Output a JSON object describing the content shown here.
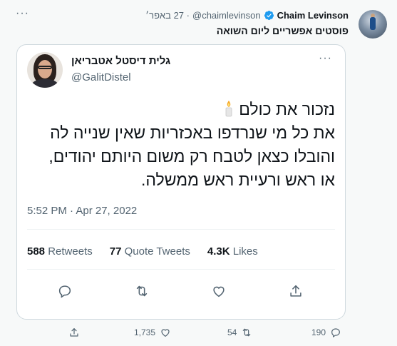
{
  "outer_tweet": {
    "author_name": "Chaim Levinson",
    "handle": "@chaimlevinson",
    "time": "· 27 באפר׳",
    "text": "פוסטים אפשריים ליום השואה",
    "more_label": "···",
    "counts": {
      "replies": "190",
      "retweets": "54",
      "likes": "1,735"
    }
  },
  "quoted_tweet": {
    "author_name": "גלית דיסטל אטבריאן",
    "handle": "@GalitDistel",
    "more_label": "···",
    "body_lines": [
      "נזכור את כולם",
      "את כל מי שנרדפו באכזריות שאין שנייה לה",
      "והובלו כצאן לטבח רק משום היותם יהודים,",
      "או ראש ורעיית ראש ממשלה."
    ],
    "timestamp": "5:52 PM · Apr 27, 2022",
    "stats": {
      "retweets_count": "588",
      "retweets_label": "Retweets",
      "quotes_count": "77",
      "quotes_label": "Quote Tweets",
      "likes_count": "4.3K",
      "likes_label": "Likes"
    }
  },
  "colors": {
    "background": "#f7f9f9",
    "text": "#0f1419",
    "secondary": "#536471",
    "border": "#cfd9de",
    "verified": "#1d9bf0",
    "candle_flame": "#f5a623"
  },
  "icons": [
    "verified-badge-icon",
    "candle-icon",
    "reply-icon",
    "retweet-icon",
    "like-icon",
    "share-icon",
    "more-icon"
  ]
}
